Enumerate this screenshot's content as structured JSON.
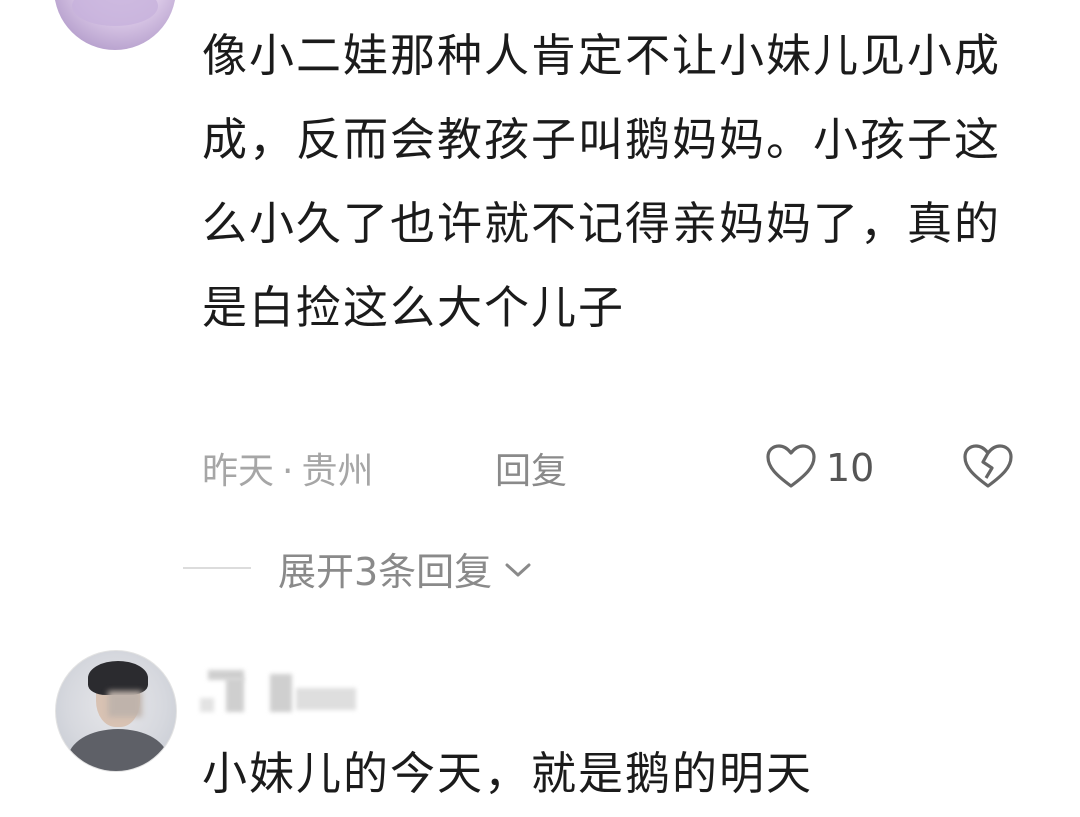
{
  "comment1": {
    "text": "像小二娃那种人肯定不让小妹儿见小成成，反而会教孩子叫鹅妈妈。小孩子这么小久了也许就不记得亲妈妈了，真的是白捡这么大个儿子",
    "time": "昨天",
    "separator": "·",
    "location": "贵州",
    "reply_label": "回复",
    "like_count": "10",
    "like_icon": "heart-outline",
    "dislike_icon": "broken-heart-outline"
  },
  "expand": {
    "label": "展开3条回复",
    "icon": "chevron-down"
  },
  "comment2": {
    "text": "小妹儿的今天，就是鹅的明天"
  },
  "colors": {
    "text": "#1b1b1b",
    "meta": "#a6a6a6",
    "reply": "#8a8a8a",
    "divider": "#dcdcdc"
  }
}
